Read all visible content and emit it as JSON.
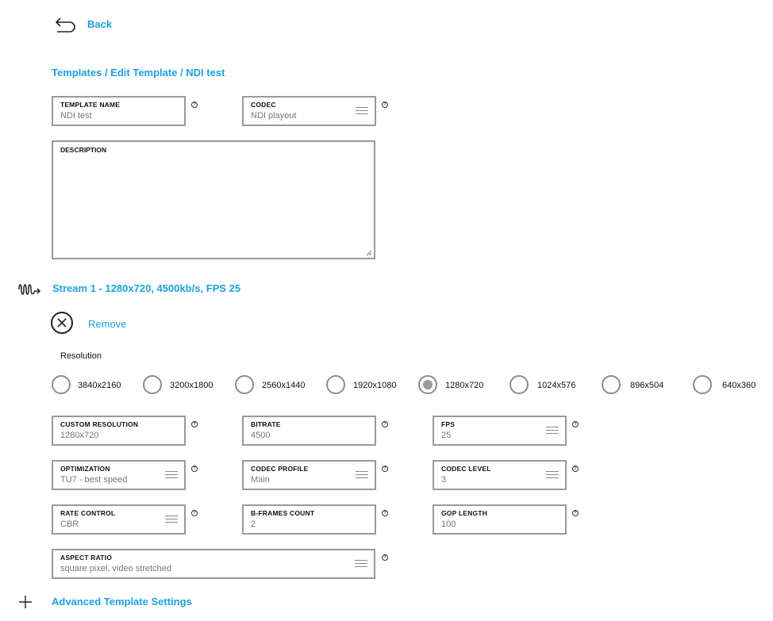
{
  "nav": {
    "back_label": "Back"
  },
  "breadcrumb": "Templates / Edit Template / NDI test",
  "template": {
    "name_label": "TEMPLATE NAME",
    "name_value": "NDI test",
    "codec_label": "CODEC",
    "codec_value": "NDI playout",
    "description_label": "DESCRIPTION",
    "description_value": ""
  },
  "stream": {
    "title": "Stream 1 - 1280x720, 4500kb/s, FPS 25",
    "remove_label": "Remove",
    "resolution_title": "Resolution",
    "resolutions": [
      "3840x2160",
      "3200x1800",
      "2560x1440",
      "1920x1080",
      "1280x720",
      "1024x576",
      "896x504",
      "640x360"
    ],
    "selected_resolution": "1280x720",
    "fields": {
      "custom_resolution": {
        "label": "CUSTOM RESOLUTION",
        "value": "1280x720"
      },
      "bitrate": {
        "label": "BITRATE",
        "value": "4500"
      },
      "fps": {
        "label": "FPS",
        "value": "25"
      },
      "optimization": {
        "label": "OPTIMIZATION",
        "value": "TU7 - best speed"
      },
      "codec_profile": {
        "label": "CODEC PROFILE",
        "value": "Main"
      },
      "codec_level": {
        "label": "CODEC LEVEL",
        "value": "3"
      },
      "rate_control": {
        "label": "RATE CONTROL",
        "value": "CBR"
      },
      "bframes": {
        "label": "B-FRAMES COUNT",
        "value": "2"
      },
      "gop": {
        "label": "GOP LENGTH",
        "value": "100"
      },
      "aspect_ratio": {
        "label": "ASPECT RATIO",
        "value": "square pixel, video stretched"
      }
    }
  },
  "advanced": {
    "label": "Advanced Template Settings"
  },
  "icons": {
    "back": "back-arrow-icon",
    "help": "question-circle-icon",
    "menu": "hamburger-menu-icon",
    "stream": "signal-wave-icon",
    "remove": "close-circle-icon",
    "plus": "plus-icon"
  },
  "colors": {
    "accent": "#1da1e0",
    "border": "#9a9a9a"
  }
}
